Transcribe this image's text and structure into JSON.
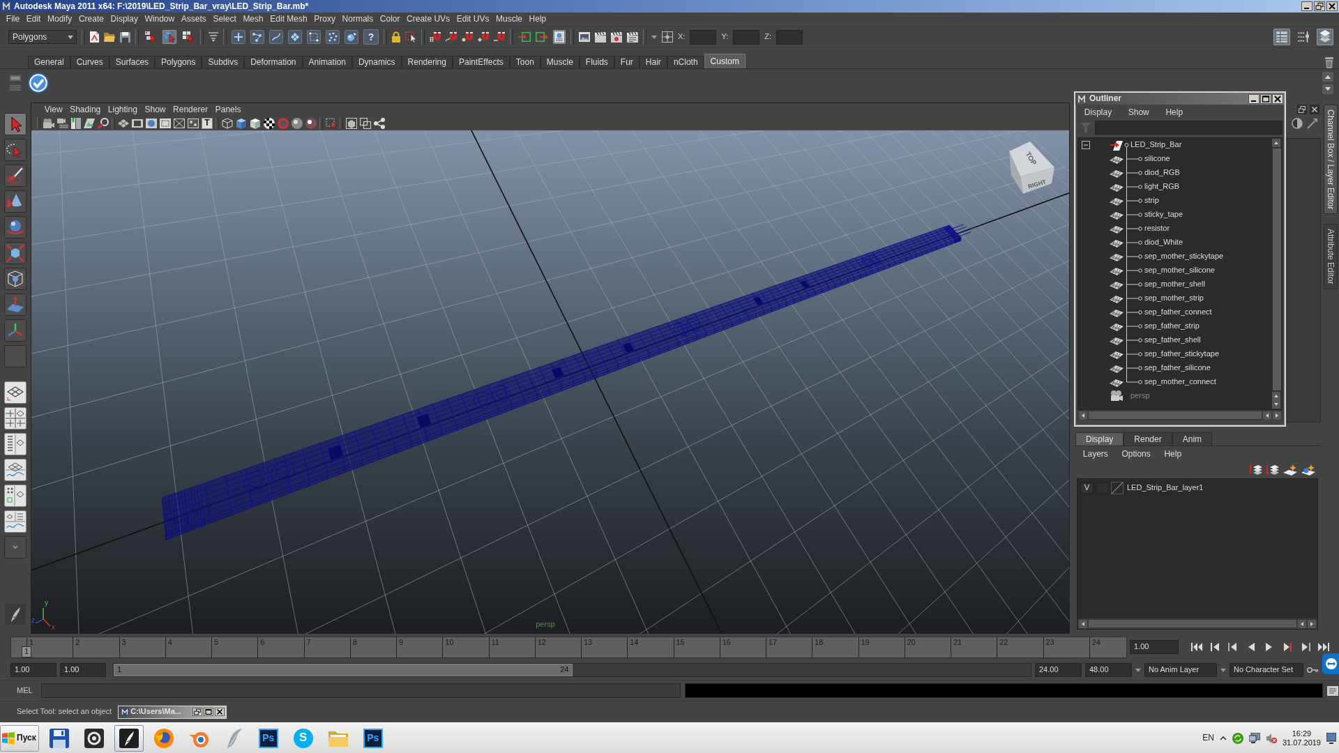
{
  "window": {
    "title": "Autodesk Maya 2011 x64: F:\\2019\\LED_Strip_Bar_vray\\LED_Strip_Bar.mb*"
  },
  "menu_bar": [
    "File",
    "Edit",
    "Modify",
    "Create",
    "Display",
    "Window",
    "Assets",
    "Select",
    "Mesh",
    "Edit Mesh",
    "Proxy",
    "Normals",
    "Color",
    "Create UVs",
    "Edit UVs",
    "Muscle",
    "Help"
  ],
  "status_line": {
    "menu_set": "Polygons",
    "selection_modes": [
      {
        "selected": false
      },
      {
        "selected": true
      },
      {
        "selected": false
      }
    ],
    "help_button": "?",
    "construction_history": {
      "on": true
    },
    "coordinate_labels": [
      "X:",
      "Y:",
      "Z:"
    ],
    "panel_toggles": [
      {
        "on": true
      },
      {
        "on": false
      },
      {
        "on": true
      }
    ]
  },
  "shelf": {
    "tabs": [
      {
        "label": "General",
        "selected": false
      },
      {
        "label": "Curves",
        "selected": false
      },
      {
        "label": "Surfaces",
        "selected": false
      },
      {
        "label": "Polygons",
        "selected": false
      },
      {
        "label": "Subdivs",
        "selected": false
      },
      {
        "label": "Deformation",
        "selected": false
      },
      {
        "label": "Animation",
        "selected": false
      },
      {
        "label": "Dynamics",
        "selected": false
      },
      {
        "label": "Rendering",
        "selected": false
      },
      {
        "label": "PaintEffects",
        "selected": false
      },
      {
        "label": "Toon",
        "selected": false
      },
      {
        "label": "Muscle",
        "selected": false
      },
      {
        "label": "Fluids",
        "selected": false
      },
      {
        "label": "Fur",
        "selected": false
      },
      {
        "label": "Hair",
        "selected": false
      },
      {
        "label": "nCloth",
        "selected": false
      },
      {
        "label": "Custom",
        "selected": true
      }
    ]
  },
  "toolbox": {
    "tools": [
      {
        "selected": true
      },
      {
        "selected": false
      },
      {
        "selected": false
      },
      {
        "selected": false
      },
      {
        "selected": false
      },
      {
        "selected": false
      },
      {
        "selected": false
      },
      {
        "selected": false
      },
      {
        "selected": false
      },
      {
        "selected": false
      }
    ]
  },
  "viewport": {
    "menus": [
      "View",
      "Shading",
      "Lighting",
      "Show",
      "Renderer",
      "Panels"
    ],
    "textured_button": "T",
    "view_cube_faces": [
      "TOP",
      "RIGHT"
    ],
    "camera_name": "persp",
    "axis_labels": [
      "y",
      "z",
      "x"
    ]
  },
  "outliner": {
    "title": "Outliner",
    "menus": [
      "Display",
      "Show",
      "Help"
    ],
    "items": [
      {
        "label": "LED_Strip_Bar",
        "kind": "group",
        "expanded": true,
        "children": [
          {
            "label": "silicone"
          },
          {
            "label": "diod_RGB"
          },
          {
            "label": "light_RGB"
          },
          {
            "label": "strip"
          },
          {
            "label": "sticky_tape"
          },
          {
            "label": "resistor"
          },
          {
            "label": "diod_White"
          },
          {
            "label": "sep_mother_stickytape"
          },
          {
            "label": "sep_mother_silicone"
          },
          {
            "label": "sep_mother_shell"
          },
          {
            "label": "sep_mother_strip"
          },
          {
            "label": "sep_father_connect"
          },
          {
            "label": "sep_father_strip"
          },
          {
            "label": "sep_father_shell"
          },
          {
            "label": "sep_father_stickytape"
          },
          {
            "label": "sep_father_silicone"
          },
          {
            "label": "sep_mother_connect"
          }
        ]
      },
      {
        "label": "persp",
        "kind": "camera"
      }
    ]
  },
  "side_tabs": [
    {
      "label": "Channel Box / Layer Editor",
      "selected": true
    },
    {
      "label": "Attribute Editor",
      "selected": false
    }
  ],
  "layer_editor": {
    "tabs": [
      {
        "label": "Display",
        "selected": true
      },
      {
        "label": "Render",
        "selected": false
      },
      {
        "label": "Anim",
        "selected": false
      }
    ],
    "menus": [
      "Layers",
      "Options",
      "Help"
    ],
    "layers": [
      {
        "visibility": "V",
        "name": "LED_Strip_Bar_layer1"
      }
    ]
  },
  "time_slider": {
    "frames": [
      "1",
      "2",
      "3",
      "4",
      "5",
      "6",
      "7",
      "8",
      "9",
      "10",
      "11",
      "12",
      "13",
      "14",
      "15",
      "16",
      "17",
      "18",
      "19",
      "20",
      "21",
      "22",
      "23",
      "24"
    ],
    "playhead": {
      "label": "1",
      "level": 0
    },
    "current_time": "1.00"
  },
  "range_slider": {
    "start_time": "1.00",
    "playback_start": "1.00",
    "range": {
      "start": "1",
      "end": "24",
      "level": 0.5
    },
    "playback_end": "24.00",
    "end_time": "48.00",
    "anim_layer": "No Anim Layer",
    "character_set": "No Character Set"
  },
  "command_line": {
    "language": "MEL"
  },
  "help_line": {
    "message": "Select Tool: select an object",
    "minimized_window": "C:\\Users\\Ma..."
  },
  "taskbar": {
    "start": "Пуск",
    "apps": [
      {
        "selected": false
      },
      {
        "selected": false
      },
      {
        "selected": true
      },
      {
        "selected": false
      },
      {
        "selected": false
      },
      {
        "selected": false
      },
      {
        "label": "Ps",
        "selected": false
      },
      {
        "label": "S",
        "selected": false
      },
      {
        "selected": false
      },
      {
        "label": "Ps",
        "selected": false
      }
    ],
    "language": "EN",
    "time": "16:29",
    "date": "31.07.2019"
  }
}
